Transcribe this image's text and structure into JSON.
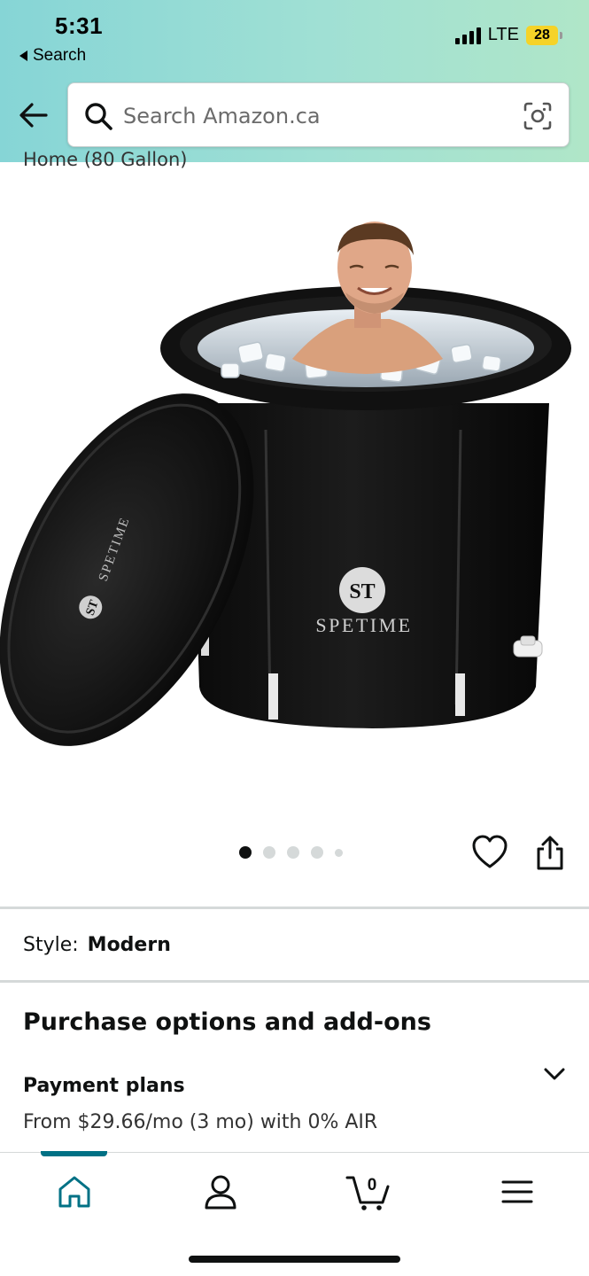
{
  "status_bar": {
    "time": "5:31",
    "back_label": "Search",
    "network": "LTE",
    "battery": "28"
  },
  "search": {
    "placeholder": "Search Amazon.ca",
    "value": ""
  },
  "product": {
    "title_fragment": "Home (80 Gallon)",
    "brand_logo": "ST",
    "brand_name": "SPETIME",
    "image_count": 5,
    "active_image": 1
  },
  "style": {
    "label": "Style:",
    "value": "Modern"
  },
  "purchase": {
    "heading": "Purchase options and add-ons",
    "payment_title": "Payment plans",
    "payment_subtitle": "From $29.66/mo (3 mo) with 0% AIR"
  },
  "bottom_nav": {
    "items": [
      "home-icon",
      "account-icon",
      "cart-icon",
      "menu-icon"
    ],
    "cart_count": "0",
    "active": "home",
    "accent": "#007185"
  }
}
